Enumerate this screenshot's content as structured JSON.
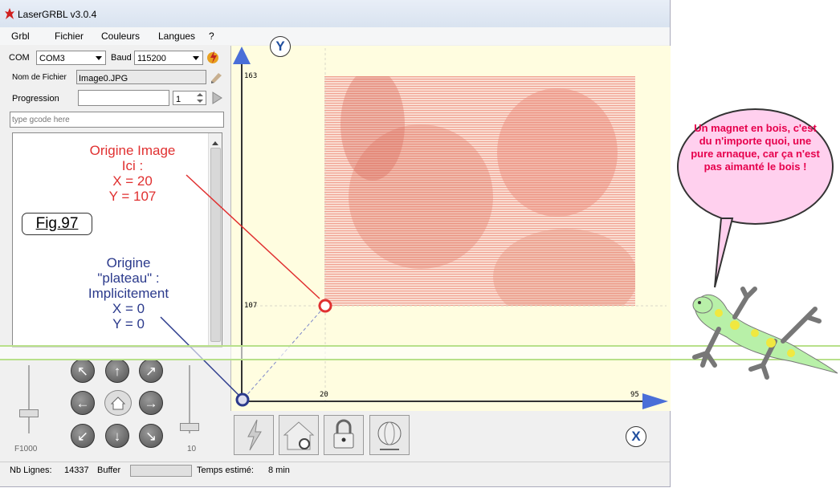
{
  "window": {
    "title": "LaserGRBL v3.0.4"
  },
  "menu": [
    "Grbl",
    "Fichier",
    "Couleurs",
    "Langues",
    "?"
  ],
  "connection": {
    "com_label": "COM",
    "com_value": "COM3",
    "baud_label": "Baud",
    "baud_value": "115200"
  },
  "file": {
    "label": "Nom de Fichier",
    "value": "Image0.JPG"
  },
  "progress": {
    "label": "Progression",
    "count": "1"
  },
  "gcode_input": {
    "placeholder": "type gcode here"
  },
  "annotations": {
    "image_origin": [
      "Origine Image",
      "Ici :",
      "X = 20",
      "Y = 107"
    ],
    "plate_origin": [
      "Origine",
      "\"plateau\" :",
      "Implicitement",
      "X = 0",
      "Y = 0"
    ],
    "figure": "Fig.97"
  },
  "jog": {
    "speed_label": "F1000",
    "step_label": "10"
  },
  "axes": {
    "y_label": "Y",
    "x_label": "X",
    "y_ticks": [
      "163",
      "107"
    ],
    "x_ticks": [
      "20",
      "95"
    ]
  },
  "status": {
    "lines_label": "Nb Lignes:",
    "lines_value": "14337",
    "buffer_label": "Buffer",
    "time_label": "Temps estimé:",
    "time_value": "8 min"
  },
  "bubble": "Un magnet en bois, c'est du n'importe quoi, une pure arnaque, car ça n'est pas aimanté le bois !",
  "colors": {
    "image_origin": "#e03030",
    "plate_origin": "#2b3a8c",
    "axis": "#4a6fd8",
    "bubble_text": "#e6004c",
    "gecko": "#b8f0a8"
  }
}
